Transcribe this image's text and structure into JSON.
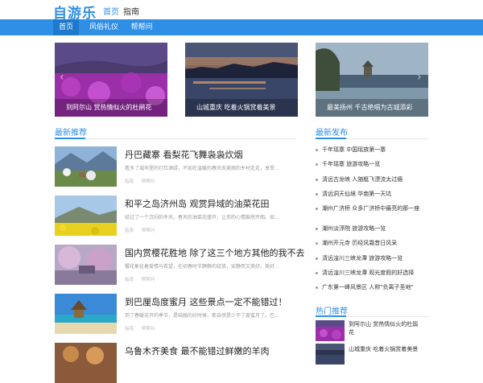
{
  "header": {
    "logo": "自游乐",
    "home_link": "首页",
    "guide_link": "指南"
  },
  "nav": {
    "items": [
      "首页",
      "风俗礼仪",
      "帮帮问"
    ]
  },
  "slider": {
    "slides": [
      "到阿尔山 赏热情似火的杜鹃花",
      "山城重庆 吃着火锅赏着美景",
      "最美扬州 千古绝唱为古城添彩"
    ]
  },
  "latest": {
    "title": "最新推荐",
    "articles": [
      {
        "title": "丹巴藏寨 看梨花飞舞袅袅炊烟",
        "desc": "看多了城市里的灯红酒绿，不如在温暖的春天去美丽的乡村走走，享受…",
        "tags": [
          "指南",
          "帮帮问"
        ]
      },
      {
        "title": "和平之岛济州岛 观赏异域的油菜花田",
        "desc": "经过了一个沉闷的冬天，春天的油菜花盛开，让你的心情豁然开朗。如…",
        "tags": [
          "指南",
          "帮帮问"
        ]
      },
      {
        "title": "国内赏樱花胜地 除了这三个地方其他的我不去",
        "desc": "樱花象征着爱情与希望，在初春时节静静的绽放，安静而又美好。美好…",
        "tags": [
          "指南",
          "帮帮问"
        ]
      },
      {
        "title": "到巴厘岛度蜜月 这些景点一定不能错过！",
        "desc": "到了春暖花开的季节，是结婚的好时候，那自然是少不了度蜜月了。巴…",
        "tags": [
          "指南",
          "帮帮问"
        ]
      },
      {
        "title": "乌鲁木齐美食 最不能错过鲜嫩的羊肉",
        "desc": "",
        "tags": []
      }
    ]
  },
  "releases": {
    "title": "最新发布",
    "items": [
      "千年瑶寨 中国瑶族第一寨",
      "千年瑶寨 旅游攻略一览",
      "清远古龙峡 人随艇飞漂流太过瘾",
      "清远洞天仙境 华南第一天坑",
      "潮州广济桥 众多广济桥中最亮的那一座",
      "潮州淡浮院 旅游攻略一览",
      "潮州开元寺 历经风霜昔日风采",
      "清远湟川三峡龙潭 旅游攻略一览",
      "清远湟川三峡龙潭 观光度假的好选择",
      "广东第一峰风景区 人称\"负离子圣地\""
    ]
  },
  "hot": {
    "title": "热门推荐",
    "items": [
      "到阿尔山 赏热情似火的杜鹃花",
      "山城重庆 吃着火锅赏着美景"
    ]
  },
  "colors": {
    "brand": "#2f8ee6",
    "nav_active": "#1e78cc"
  }
}
